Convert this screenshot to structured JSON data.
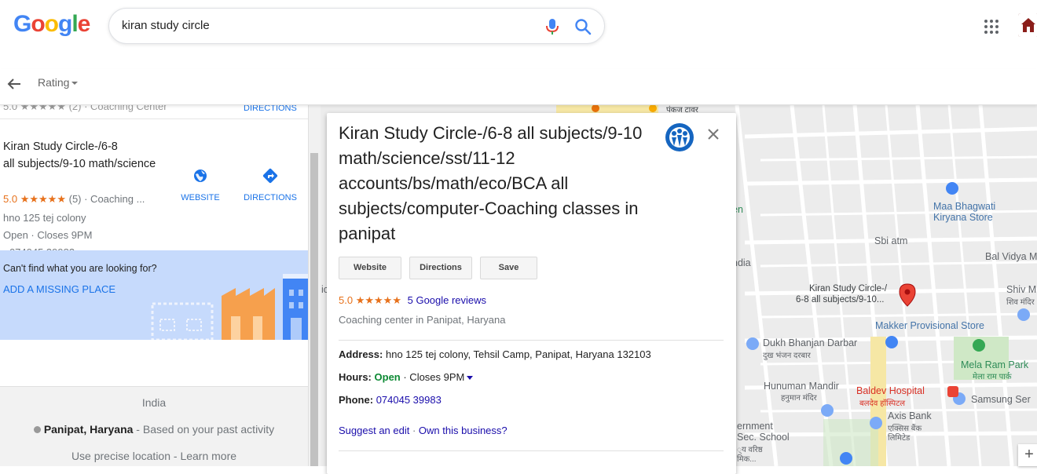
{
  "header": {
    "logo_letters": [
      "G",
      "o",
      "o",
      "g",
      "l",
      "e"
    ],
    "logo_colors": [
      "#4285f4",
      "#ea4335",
      "#fbbc05",
      "#4285f4",
      "#34a853",
      "#ea4335"
    ],
    "search_query": "kiran study circle",
    "mic_icon": "mic-icon",
    "search_icon": "search-icon",
    "apps_icon": "apps-grid-icon"
  },
  "toolbar": {
    "back_icon": "back-arrow-icon",
    "rating_filter": "Rating"
  },
  "left_panel": {
    "partial_row": {
      "rating_text": "5.0 ★★★★★ (2) · Coaching Center",
      "directions": "DIRECTIONS"
    },
    "result": {
      "title_line1": "Kiran Study Circle-/6-8",
      "title_line2": "all subjects/9-10 math/science",
      "rating": "5.0",
      "stars": "★★★★★",
      "count_category": "(5) · Coaching ...",
      "address": "hno 125 tej colony",
      "hours": "Open · Closes 9PM",
      "phone": "· 074045 39983",
      "website_label": "WEBSITE",
      "directions_label": "DIRECTIONS"
    },
    "missing_place": {
      "question": "Can't find what you are looking for?",
      "link": "ADD A MISSING PLACE"
    },
    "footer": {
      "country": "India",
      "location_bold": "Panipat, Haryana",
      "location_rest": " - Based on your past activity",
      "precise": "Use precise location - Learn more"
    }
  },
  "card": {
    "title": "Kiran Study Circle-/6-8 all subjects/9-10 math/science/sst/11-12 accounts/bs/math/eco/BCA all subjects/computer-Coaching classes in panipat",
    "buttons": {
      "website": "Website",
      "directions": "Directions",
      "save": "Save"
    },
    "rating": "5.0",
    "stars": "★★★★★",
    "reviews": "5 Google reviews",
    "category": "Coaching center in Panipat, Haryana",
    "address_label": "Address:",
    "address": "hno 125 tej colony, Tehsil Camp, Panipat, Haryana 132103",
    "hours_label": "Hours:",
    "hours_open": "Open",
    "hours_close": " · Closes 9PM",
    "phone_label": "Phone:",
    "phone": "074045 39983",
    "suggest_edit": "Suggest an edit",
    "separator": " · ",
    "own_business": "Own this business?"
  },
  "map": {
    "labels": {
      "pankaj": "पंकज टावर",
      "maa_bhagwati_1": "Maa Bhagwati",
      "maa_bhagwati_2": "Kiryana Store",
      "sbi": "Sbi atm",
      "bal_vidya": "Bal Vidya M",
      "pin_line1": "Kiran Study Circle-/",
      "pin_line2": "6-8 all subjects/9-10...",
      "shiv_1": "Shiv M",
      "shiv_2": "शिव मंदिर",
      "makker": "Makker Provisional Store",
      "dukh_1": "Dukh Bhanjan Darbar",
      "dukh_2": "दुख भंजन दरबार",
      "mela_1": "Mela Ram Park",
      "mela_2": "मेला राम पार्क",
      "hunuman_1": "Hunuman Mandir",
      "hunuman_2": "हनुमान मंदिर",
      "baldev_1": "Baldev Hospital",
      "baldev_2": "बलदेव हॉस्पिटल",
      "samsung": "Samsung Ser",
      "axis_1": "Axis Bank",
      "axis_2": "एक्सिस बैंक",
      "axis_3": "लिमिटेड",
      "ernment_1": "ernment",
      "ernment_2": "Sec. School",
      "ernment_3": "्य वरिष्ठ",
      "ernment_4": "मिक...",
      "en": "en",
      "ndia": "ndia",
      "ic": "ic"
    },
    "zoom_in": "+"
  }
}
